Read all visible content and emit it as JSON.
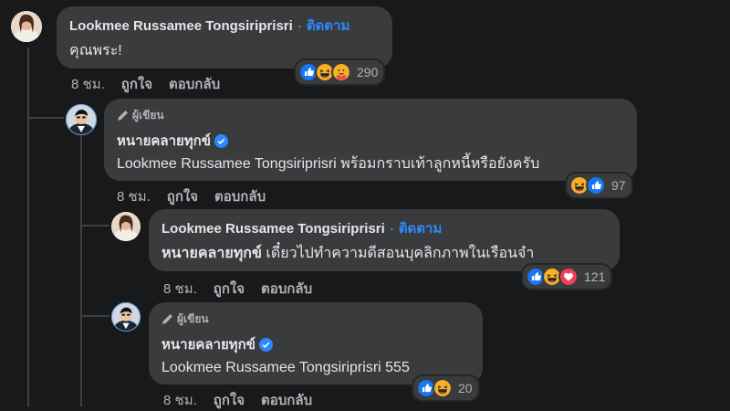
{
  "comments": [
    {
      "author": "Lookmee Russamee Tongsiriprisri",
      "follow": "ติดตาม",
      "text": "คุณพระ!",
      "time": "8 ชม.",
      "like": "ถูกใจ",
      "reply": "ตอบกลับ",
      "reactions": [
        "like-icon",
        "haha-icon",
        "care-icon"
      ],
      "reaction_count": "290"
    },
    {
      "author_badge": "ผู้เขียน",
      "author": "หนายคลายทุกข์",
      "text": "Lookmee Russamee Tongsiriprisri พร้อมกราบเท้าลูกหนี้หรือยังครับ",
      "time": "8 ชม.",
      "like": "ถูกใจ",
      "reply": "ตอบกลับ",
      "reactions": [
        "haha-icon",
        "like-icon"
      ],
      "reaction_count": "97"
    },
    {
      "author": "Lookmee Russamee Tongsiriprisri",
      "follow": "ติดตาม",
      "text_mention": "หนายคลายทุกข์",
      "text": "เดี๋ยวไปทำความดีสอนบุคลิกภาพในเรือนจำ",
      "time": "8 ชม.",
      "like": "ถูกใจ",
      "reply": "ตอบกลับ",
      "reactions": [
        "like-icon",
        "haha-icon",
        "love-icon"
      ],
      "reaction_count": "121"
    },
    {
      "author_badge": "ผู้เขียน",
      "author": "หนายคลายทุกข์",
      "text": "Lookmee Russamee Tongsiriprisri 555",
      "time": "8 ชม.",
      "like": "ถูกใจ",
      "reply": "ตอบกลับ",
      "reactions": [
        "like-icon",
        "haha-icon"
      ],
      "reaction_count": "20"
    }
  ],
  "colors": {
    "background": "#18191a",
    "bubble": "#3a3b3c",
    "follow": "#2d88ff",
    "muted": "#b0b3b8"
  }
}
